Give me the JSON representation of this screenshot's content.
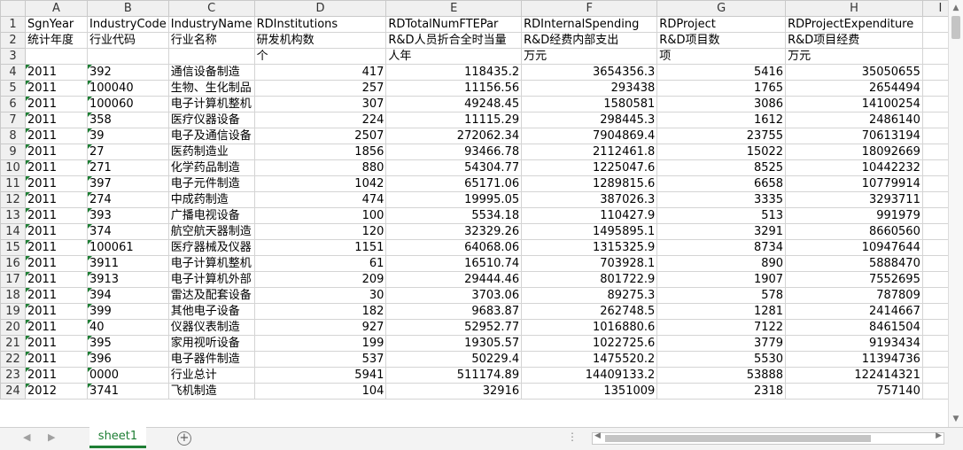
{
  "columns": [
    "A",
    "B",
    "C",
    "D",
    "E",
    "F",
    "G",
    "H",
    "I"
  ],
  "header_rows": [
    {
      "row": "1",
      "cells": [
        "SgnYear",
        "IndustryCode",
        "IndustryName",
        "RDInstitutions",
        "RDTotalNumFTEPar",
        "RDInternalSpending",
        "RDProject",
        "RDProjectExpenditure",
        ""
      ]
    },
    {
      "row": "2",
      "cells": [
        "统计年度",
        "行业代码",
        "行业名称",
        "研发机构数",
        "R&D人员折合全时当量",
        "R&D经费内部支出",
        "R&D项目数",
        "R&D项目经费",
        ""
      ]
    },
    {
      "row": "3",
      "cells": [
        "",
        "",
        "",
        "个",
        "人年",
        "万元",
        "项",
        "万元",
        ""
      ]
    }
  ],
  "data_rows": [
    {
      "row": "4",
      "cells": [
        "2011",
        "392",
        "通信设备制造",
        "417",
        "118435.2",
        "3654356.3",
        "5416",
        "35050655",
        ""
      ]
    },
    {
      "row": "5",
      "cells": [
        "2011",
        "100040",
        "生物、生化制品",
        "257",
        "11156.56",
        "293438",
        "1765",
        "2654494",
        ""
      ]
    },
    {
      "row": "6",
      "cells": [
        "2011",
        "100060",
        "电子计算机整机",
        "307",
        "49248.45",
        "1580581",
        "3086",
        "14100254",
        ""
      ]
    },
    {
      "row": "7",
      "cells": [
        "2011",
        "358",
        "医疗仪器设备",
        "224",
        "11115.29",
        "298445.3",
        "1612",
        "2486140",
        ""
      ]
    },
    {
      "row": "8",
      "cells": [
        "2011",
        "39",
        "电子及通信设备",
        "2507",
        "272062.34",
        "7904869.4",
        "23755",
        "70613194",
        ""
      ]
    },
    {
      "row": "9",
      "cells": [
        "2011",
        "27",
        "医药制造业",
        "1856",
        "93466.78",
        "2112461.8",
        "15022",
        "18092669",
        ""
      ]
    },
    {
      "row": "10",
      "cells": [
        "2011",
        "271",
        "化学药品制造",
        "880",
        "54304.77",
        "1225047.6",
        "8525",
        "10442232",
        ""
      ]
    },
    {
      "row": "11",
      "cells": [
        "2011",
        "397",
        "电子元件制造",
        "1042",
        "65171.06",
        "1289815.6",
        "6658",
        "10779914",
        ""
      ]
    },
    {
      "row": "12",
      "cells": [
        "2011",
        "274",
        "中成药制造",
        "474",
        "19995.05",
        "387026.3",
        "3335",
        "3293711",
        ""
      ]
    },
    {
      "row": "13",
      "cells": [
        "2011",
        "393",
        "广播电视设备",
        "100",
        "5534.18",
        "110427.9",
        "513",
        "991979",
        ""
      ]
    },
    {
      "row": "14",
      "cells": [
        "2011",
        "374",
        "航空航天器制造",
        "120",
        "32329.26",
        "1495895.1",
        "3291",
        "8660560",
        ""
      ]
    },
    {
      "row": "15",
      "cells": [
        "2011",
        "100061",
        "医疗器械及仪器",
        "1151",
        "64068.06",
        "1315325.9",
        "8734",
        "10947644",
        ""
      ]
    },
    {
      "row": "16",
      "cells": [
        "2011",
        "3911",
        "电子计算机整机",
        "61",
        "16510.74",
        "703928.1",
        "890",
        "5888470",
        ""
      ]
    },
    {
      "row": "17",
      "cells": [
        "2011",
        "3913",
        "电子计算机外部",
        "209",
        "29444.46",
        "801722.9",
        "1907",
        "7552695",
        ""
      ]
    },
    {
      "row": "18",
      "cells": [
        "2011",
        "394",
        "雷达及配套设备",
        "30",
        "3703.06",
        "89275.3",
        "578",
        "787809",
        ""
      ]
    },
    {
      "row": "19",
      "cells": [
        "2011",
        "399",
        "其他电子设备",
        "182",
        "9683.87",
        "262748.5",
        "1281",
        "2414667",
        ""
      ]
    },
    {
      "row": "20",
      "cells": [
        "2011",
        "40",
        "仪器仪表制造",
        "927",
        "52952.77",
        "1016880.6",
        "7122",
        "8461504",
        ""
      ]
    },
    {
      "row": "21",
      "cells": [
        "2011",
        "395",
        "家用视听设备",
        "199",
        "19305.57",
        "1022725.6",
        "3779",
        "9193434",
        ""
      ]
    },
    {
      "row": "22",
      "cells": [
        "2011",
        "396",
        "电子器件制造",
        "537",
        "50229.4",
        "1475520.2",
        "5530",
        "11394736",
        ""
      ]
    },
    {
      "row": "23",
      "cells": [
        "2011",
        "0000",
        "行业总计",
        "5941",
        "511174.89",
        "14409133.2",
        "53888",
        "122414321",
        ""
      ]
    },
    {
      "row": "24",
      "cells": [
        "2012",
        "3741",
        "飞机制造",
        "104",
        "32916",
        "1351009",
        "2318",
        "757140",
        ""
      ]
    }
  ],
  "sheet_tab": "sheet1",
  "nav_prev": "◀",
  "nav_next": "▶",
  "add_sheet": "+",
  "scroll_dots": "⋮",
  "accent_color": "#1e7e34"
}
